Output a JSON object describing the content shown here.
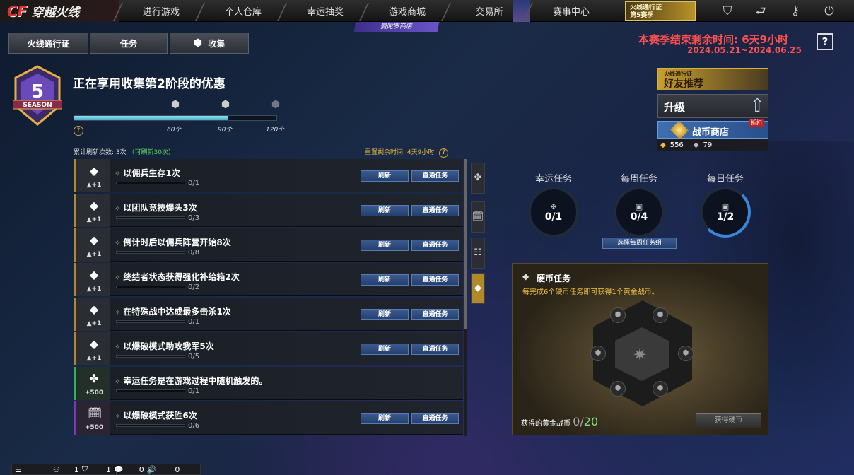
{
  "topbar": {
    "logo_latin": "CF",
    "logo_text": "穿越火线",
    "nav": [
      "进行游戏",
      "个人仓库",
      "幸运抽奖",
      "游戏商城",
      "交易所",
      "赛事中心"
    ],
    "promo_line1": "火线通行证",
    "promo_line2": "第5赛季",
    "icons": [
      "shield-icon",
      "return-icon",
      "wrench-icon",
      "power-icon"
    ]
  },
  "subtabs": [
    "火线通行证",
    "任务",
    "收集"
  ],
  "shop_badge": "曼陀罗商店",
  "season": {
    "end_label": "本赛季结束剩余时间:",
    "end_value": "6天9小时",
    "date_range": "2024.05.21~2024.06.25",
    "help": "?",
    "badge_number": "5",
    "badge_text": "SEASON"
  },
  "collect": {
    "headline": "正在享用收集第2阶段的优惠",
    "progress": 0.76,
    "milestones": [
      "60个",
      "90个",
      "120个"
    ]
  },
  "refresh": {
    "count_label": "累计刷新次数: 3次",
    "available": "（可刷新30次）",
    "reset_label": "重置剩余时间:",
    "reset_value": "4天9小时"
  },
  "buttons": {
    "refresh": "刷新",
    "complete": "直通任务"
  },
  "tasks": [
    {
      "type": "coin",
      "reward": "▲+1",
      "name": "以佣兵生存1次",
      "progress": "0/1",
      "actions": true
    },
    {
      "type": "coin",
      "reward": "▲+1",
      "name": "以团队竞技爆头3次",
      "progress": "0/3",
      "actions": true
    },
    {
      "type": "coin",
      "reward": "▲+1",
      "name": "倒计时后以佣兵阵营开始8次",
      "progress": "0/8",
      "actions": true
    },
    {
      "type": "coin",
      "reward": "▲+1",
      "name": "终结者状态获得强化补给箱2次",
      "progress": "0/2",
      "actions": true
    },
    {
      "type": "coin",
      "reward": "▲+1",
      "name": "在特殊战中达成最多击杀1次",
      "progress": "0/1",
      "actions": true
    },
    {
      "type": "coin",
      "reward": "▲+1",
      "name": "以爆破模式助攻我军5次",
      "progress": "0/5",
      "actions": true
    },
    {
      "type": "lucky",
      "reward": "+500",
      "name": "幸运任务是在游戏过程中随机触发的。",
      "progress": "0/1",
      "actions": false
    },
    {
      "type": "weekly",
      "reward": "+500",
      "name": "以爆破模式获胜6次",
      "progress": "0/6",
      "actions": true
    }
  ],
  "side_panel": {
    "promo_small": "火线通行证",
    "promo_big": "好友推荐",
    "upgrade": "升级",
    "warshop": "战币商店",
    "discount": "折扣",
    "currency_gold": "556",
    "currency_silver": "79"
  },
  "rings": [
    {
      "label": "幸运任务",
      "value": "0/1",
      "icon": "clover-icon"
    },
    {
      "label": "每周任务",
      "value": "0/4",
      "icon": "calendar-week-icon"
    },
    {
      "label": "每日任务",
      "value": "1/2",
      "icon": "calendar-day-icon"
    }
  ],
  "weekly_group_btn": "选择每周任务组",
  "coin_task": {
    "title": "硬币任务",
    "desc": "每完成6个硬币任务即可获得1个黄金战币。",
    "got_label": "获得的黄金战币",
    "got_value": "0/",
    "got_total": "20",
    "button": "获得硬币"
  },
  "bottombar": {
    "v1": "1",
    "v2": "1",
    "v3": "0",
    "v4": "0"
  },
  "colors": {
    "accent_gold": "#b08a2a",
    "accent_blue": "#3a5a90",
    "season_red": "#ff5050",
    "lucky_green": "#2fb35a",
    "weekly_purple": "#7a3ab8"
  }
}
